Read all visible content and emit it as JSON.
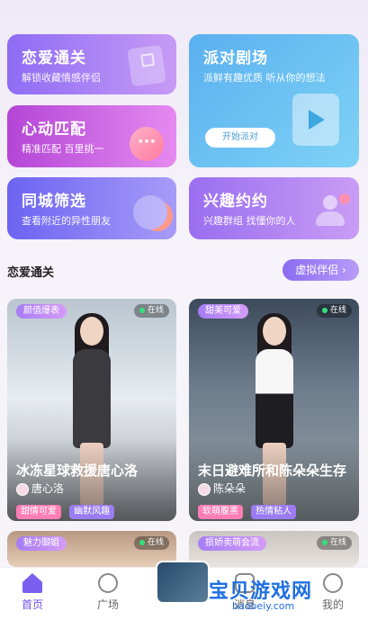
{
  "cards": [
    {
      "title": "恋爱通关",
      "subtitle": "解锁收藏情感伴侣"
    },
    {
      "title": "心动匹配",
      "subtitle": "精准匹配 百里挑一"
    },
    {
      "title": "同城筛选",
      "subtitle": "查看附近的异性朋友"
    },
    {
      "title": "派对剧场",
      "subtitle": "派鲜有趣优质 听从你的想法",
      "button": "开始派对"
    },
    {
      "title": "兴趣约约",
      "subtitle": "兴趣群组 找懂你的人"
    }
  ],
  "section": {
    "title": "恋爱通关",
    "button": "虚拟伴侣 ›"
  },
  "profiles": [
    {
      "tag": "颜值爆表",
      "status": "在线",
      "title": "冰冻星球救援唐心洛",
      "user": "唐心洛",
      "tags": [
        "甜情可爱",
        "幽默风趣"
      ]
    },
    {
      "tag": "甜美可爱",
      "status": "在线",
      "title": "末日避难所和陈朵朵生存",
      "user": "陈朵朵",
      "tags": [
        "软萌腹黑",
        "热情粘人"
      ]
    },
    {
      "tag": "魅力御姐",
      "status": "在线"
    },
    {
      "tag": "损娇卖萌会流",
      "status": "在线"
    }
  ],
  "tabs": {
    "home": "首页",
    "square": "广场",
    "message": "消息",
    "me": "我的"
  },
  "watermark": {
    "main": "宝贝游戏网",
    "sub": "baobeiy.com"
  },
  "colors": {
    "accent": "#7b5ff0",
    "online": "#35e07a"
  }
}
